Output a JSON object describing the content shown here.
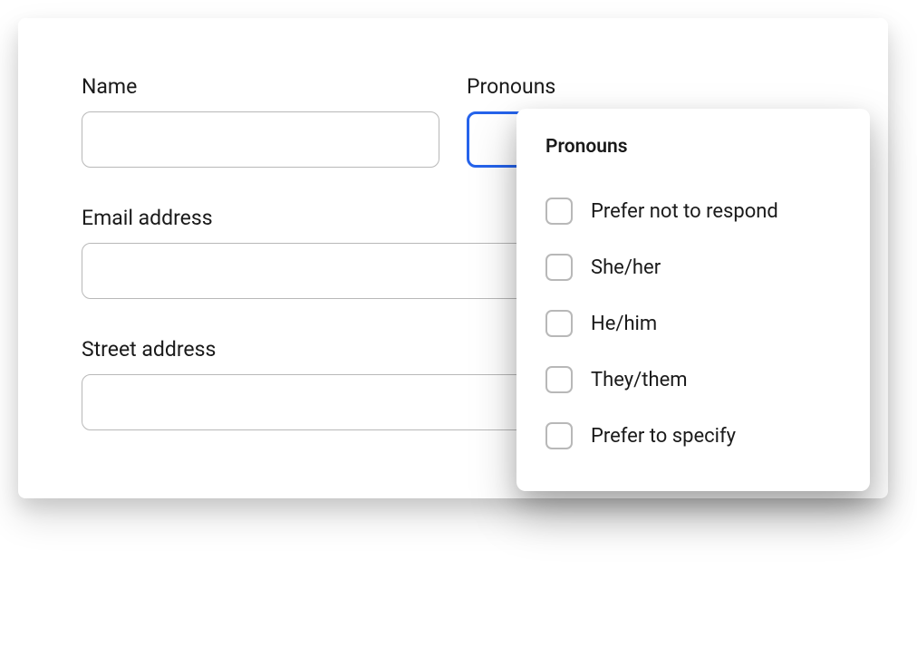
{
  "form": {
    "name": {
      "label": "Name",
      "value": ""
    },
    "pronouns": {
      "label": "Pronouns",
      "value": ""
    },
    "email": {
      "label": "Email address",
      "value": ""
    },
    "street": {
      "label": "Street address",
      "value": ""
    }
  },
  "dropdown": {
    "title": "Pronouns",
    "options": [
      "Prefer not to respond",
      "She/her",
      "He/him",
      "They/them",
      "Prefer to specify"
    ]
  }
}
